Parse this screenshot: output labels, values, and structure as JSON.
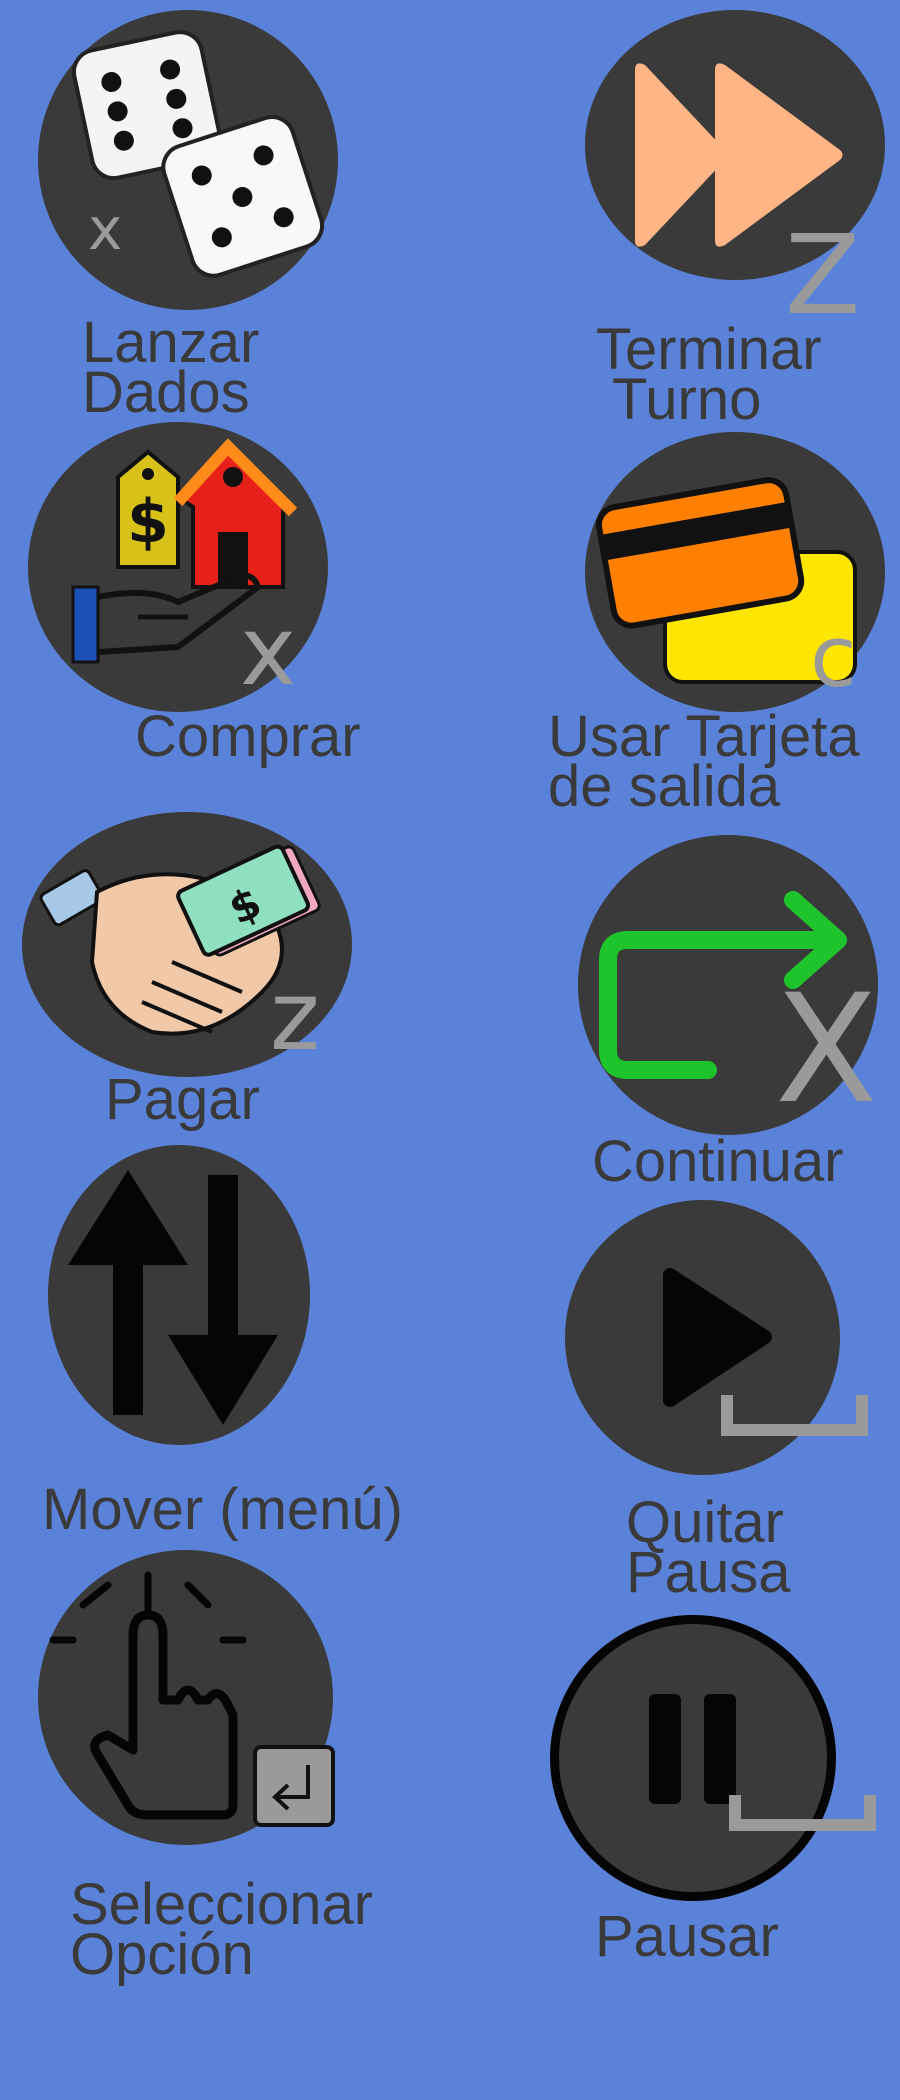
{
  "colors": {
    "background": "#5a82d8",
    "circle": "#3a3a3a",
    "label": "#3a3a3a",
    "key": "#9a9a9a"
  },
  "buttons": [
    {
      "name": "Lanzar Dados",
      "line1": "Lanzar",
      "line2": "Dados",
      "key": "x",
      "icon": "dice-icon"
    },
    {
      "name": "Terminar Turno",
      "line1": "Terminar",
      "line2": "Turno",
      "key": "Z",
      "icon": "fast-forward-icon"
    },
    {
      "name": "Comprar",
      "line1": "Comprar",
      "key": "x",
      "icon": "buy-property-icon"
    },
    {
      "name": "Usar Tarjeta de salida",
      "line1": "Usar Tarjeta",
      "line2": "de salida",
      "key": "c",
      "icon": "cards-icon"
    },
    {
      "name": "Pagar",
      "line1": "Pagar",
      "key": "z",
      "icon": "handshake-money-icon"
    },
    {
      "name": "Continuar",
      "line1": "Continuar",
      "key": "X",
      "icon": "continue-arrow-icon"
    },
    {
      "name": "Mover (menú)",
      "line1": "Mover (menú)",
      "key": "",
      "icon": "up-down-arrows-icon"
    },
    {
      "name": "Quitar Pausa",
      "line1": "Quitar",
      "line2": "Pausa",
      "key": "space",
      "icon": "play-icon"
    },
    {
      "name": "Seleccionar Opción",
      "line1": "Seleccionar",
      "line2": "Opción",
      "key": "enter",
      "icon": "pointer-hand-icon"
    },
    {
      "name": "Pausar",
      "line1": "Pausar",
      "key": "space",
      "icon": "pause-icon"
    }
  ]
}
